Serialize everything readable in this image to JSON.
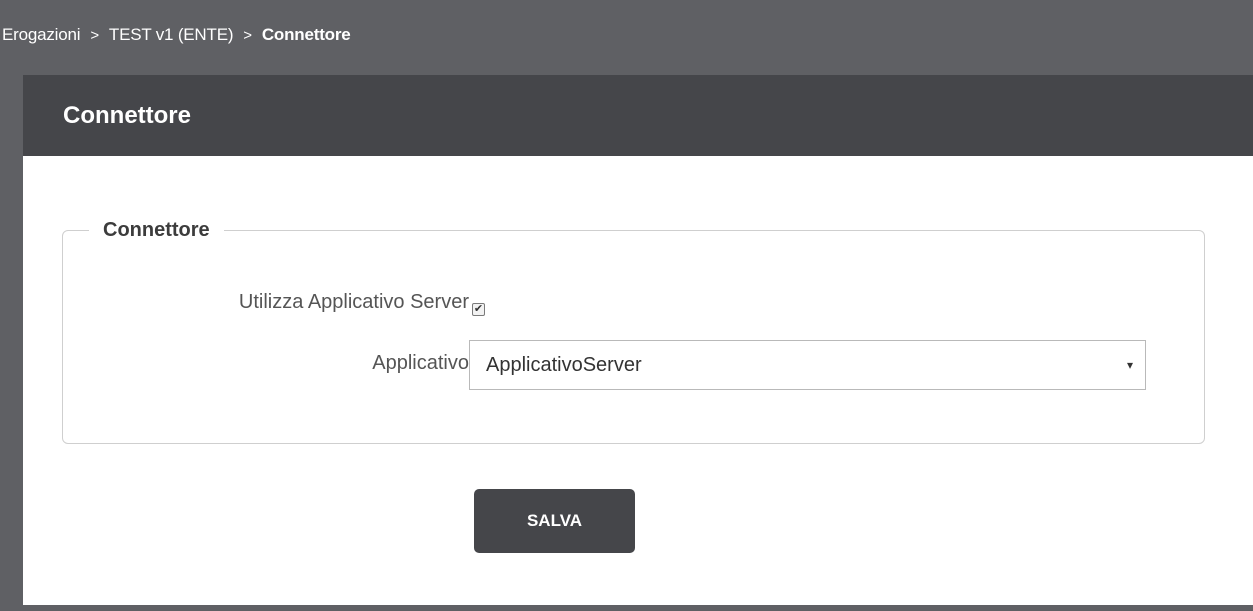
{
  "breadcrumb": {
    "items": [
      "Erogazioni",
      "TEST v1 (ENTE)"
    ],
    "separator": ">",
    "current": "Connettore"
  },
  "card": {
    "title": "Connettore",
    "section": {
      "legend": "Connettore",
      "use_server_label": "Utilizza Applicativo Server",
      "use_server_checked": true,
      "applicativo_label": "Applicativo",
      "applicativo_value": "ApplicativoServer",
      "dropdown_caret": "▾"
    },
    "save_label": "SALVA"
  },
  "colors": {
    "page_bg": "#5f6064",
    "header_bg": "#45464a",
    "button_bg": "#45464a",
    "card_bg": "#ffffff"
  }
}
